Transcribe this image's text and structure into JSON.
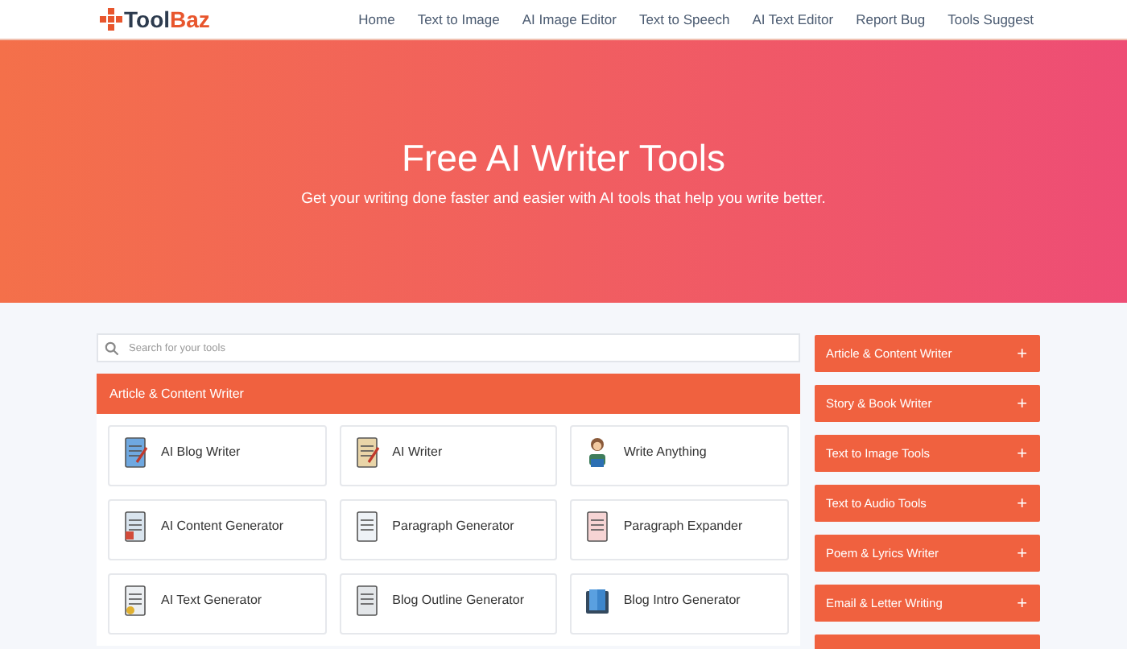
{
  "header": {
    "logo": [
      "Tool",
      "Baz"
    ],
    "nav": [
      "Home",
      "Text to Image",
      "AI Image Editor",
      "Text to Speech",
      "AI Text Editor",
      "Report Bug",
      "Tools Suggest"
    ]
  },
  "hero": {
    "title": "Free AI Writer Tools",
    "subtitle": "Get your writing done faster and easier with AI tools that help you write better."
  },
  "search": {
    "placeholder": "Search for your tools"
  },
  "section": {
    "title": "Article & Content Writer",
    "tools": [
      "AI Blog Writer",
      "AI Writer",
      "Write Anything",
      "AI Content Generator",
      "Paragraph Generator",
      "Paragraph Expander",
      "AI Text Generator",
      "Blog Outline Generator",
      "Blog Intro Generator"
    ]
  },
  "sidebar": {
    "expand_sign": "+",
    "categories": [
      "Article & Content Writer",
      "Story & Book Writer",
      "Text to Image Tools",
      "Text to Audio Tools",
      "Poem & Lyrics Writer",
      "Email & Letter Writing"
    ]
  }
}
